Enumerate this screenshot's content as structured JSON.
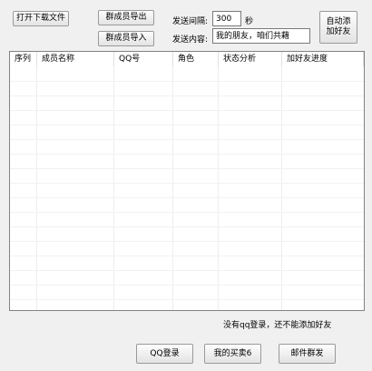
{
  "toolbar": {
    "open_download_file": "打开下载文件",
    "export_members": "群成员导出",
    "import_members": "群成员导入",
    "interval_label": "发送间隔:",
    "interval_value": "300",
    "interval_unit": "秒",
    "content_label": "发送内容:",
    "content_value": "我的朋友，咱们共藉",
    "auto_add_line1": "自动添",
    "auto_add_line2": "加好友"
  },
  "table": {
    "columns": [
      "序列",
      "成员名称",
      "QQ号",
      "角色",
      "状态分析",
      "加好友进度"
    ]
  },
  "status": {
    "message": "没有qq登录，还不能添加好友"
  },
  "footer": {
    "qq_login": "QQ登录",
    "my_buy": "我的买卖6",
    "mail_broadcast": "邮件群发"
  }
}
